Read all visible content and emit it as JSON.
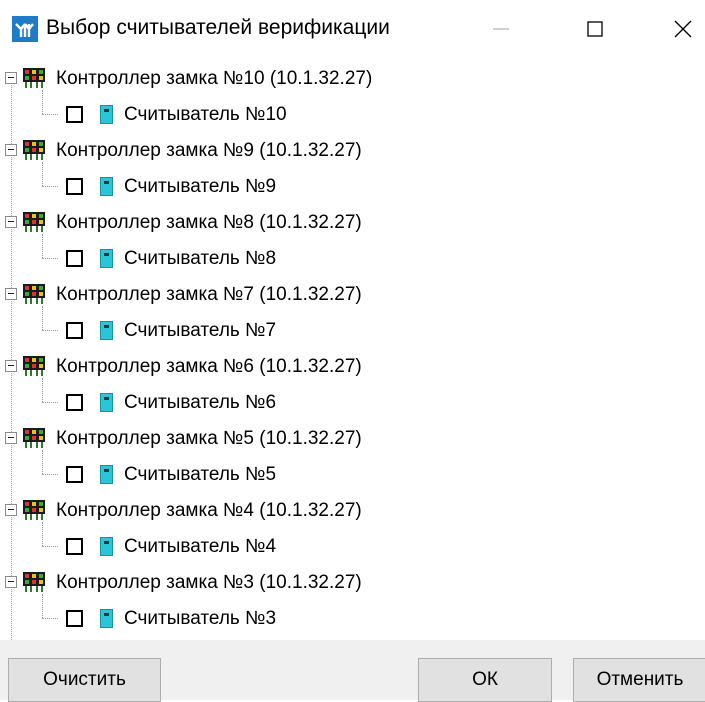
{
  "window": {
    "title": "Выбор считывателей верификации",
    "icon": "app-logo-icon",
    "controls": [
      "minimize-icon",
      "maximize-icon",
      "close-icon"
    ]
  },
  "tree": [
    {
      "controller": "Контроллер замка №10 (10.1.32.27)",
      "reader": "Считыватель №10",
      "checked": false
    },
    {
      "controller": "Контроллер замка №9 (10.1.32.27)",
      "reader": "Считыватель №9",
      "checked": false
    },
    {
      "controller": "Контроллер замка №8 (10.1.32.27)",
      "reader": "Считыватель №8",
      "checked": false
    },
    {
      "controller": "Контроллер замка №7 (10.1.32.27)",
      "reader": "Считыватель №7",
      "checked": false
    },
    {
      "controller": "Контроллер замка №6 (10.1.32.27)",
      "reader": "Считыватель №6",
      "checked": false
    },
    {
      "controller": "Контроллер замка №5 (10.1.32.27)",
      "reader": "Считыватель №5",
      "checked": false
    },
    {
      "controller": "Контроллер замка №4 (10.1.32.27)",
      "reader": "Считыватель №4",
      "checked": false
    },
    {
      "controller": "Контроллер замка №3 (10.1.32.27)",
      "reader": "Считыватель №3",
      "checked": false
    }
  ],
  "buttons": {
    "clear": "Очистить",
    "ok": "ОК",
    "cancel": "Отменить"
  },
  "colors": {
    "app_icon_bg": "#1e7bc8",
    "reader_icon": "#2bc4d8",
    "button_bg": "#e1e1e1",
    "footer_bg": "#f0f0f0"
  }
}
